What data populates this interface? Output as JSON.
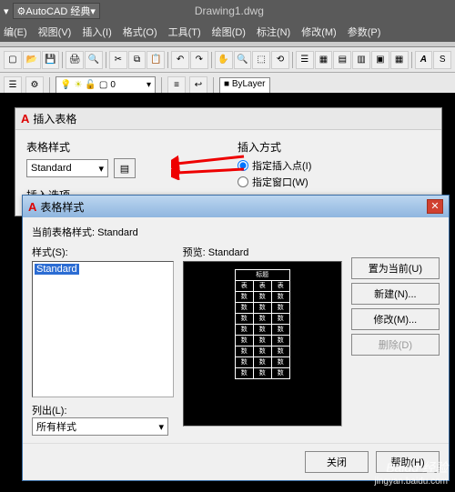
{
  "app": {
    "workspace": "AutoCAD 经典",
    "title": "Drawing1.dwg"
  },
  "menus": [
    "编(E)",
    "视图(V)",
    "插入(I)",
    "格式(O)",
    "工具(T)",
    "绘图(D)",
    "标注(N)",
    "修改(M)",
    "参数(P)"
  ],
  "layer": {
    "current": "0",
    "bylayer": "ByLayer"
  },
  "insert_table_dialog": {
    "title": "插入表格",
    "style_label": "表格样式",
    "style_value": "Standard",
    "options_label": "插入选项",
    "insert_mode_label": "插入方式",
    "mode1": "指定插入点(I)",
    "mode2": "指定窗口(W)"
  },
  "table_style_dialog": {
    "title": "表格样式",
    "current_label": "当前表格样式:",
    "current_value": "Standard",
    "styles_label": "样式(S):",
    "style_item": "Standard",
    "preview_label": "预览:",
    "preview_value": "Standard",
    "list_label": "列出(L):",
    "list_value": "所有样式",
    "btn_set_current": "置为当前(U)",
    "btn_new": "新建(N)...",
    "btn_modify": "修改(M)...",
    "btn_delete": "删除(D)",
    "btn_close": "关闭",
    "btn_help": "帮助(H)",
    "preview_header": "标题"
  },
  "watermark": {
    "brand": "Baidu 经验",
    "url": "jingyan.baidu.com"
  }
}
